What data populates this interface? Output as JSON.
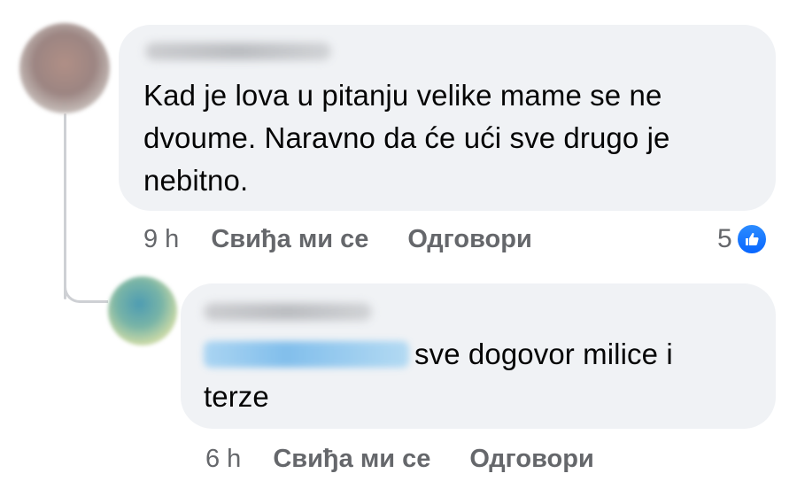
{
  "comments": [
    {
      "text": "Kad je lova u pitanju velike mame se ne dvoume. Naravno da će ući sve drugo je nebitno.",
      "time": "9 h",
      "like_label": "Свиђа ми се",
      "reply_label": "Одговори",
      "reaction_count": "5",
      "reaction_icon": "like-icon"
    }
  ],
  "replies": [
    {
      "text": "sve dogovor milice i terze",
      "time": "6 h",
      "like_label": "Свиђа ми се",
      "reply_label": "Одговори"
    }
  ],
  "colors": {
    "bubble": "#f0f2f5",
    "secondary_text": "#65676b",
    "like_blue": "#0866ff",
    "thread_line": "#ced0d4"
  }
}
